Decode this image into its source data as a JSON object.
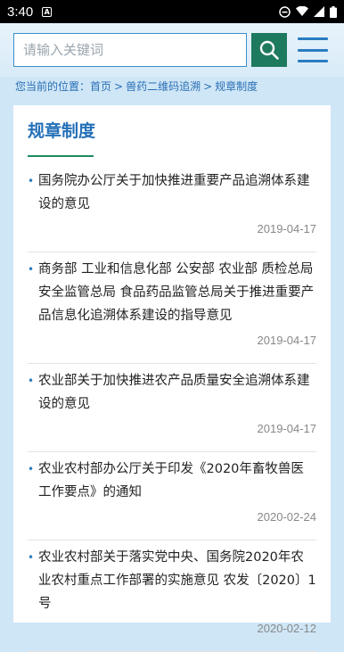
{
  "status_bar": {
    "time": "3:40",
    "notification_letter": "A"
  },
  "search": {
    "placeholder": "请输入关键词"
  },
  "breadcrumb": {
    "prefix": "您当前的位置：",
    "home": "首页",
    "sep1": ">",
    "section": "兽药二维码追溯",
    "sep2": ">",
    "current": "规章制度"
  },
  "page": {
    "title": "规章制度"
  },
  "articles": [
    {
      "title": "国务院办公厅关于加快推进重要产品追溯体系建设的意见",
      "date": "2019-04-17"
    },
    {
      "title": "商务部 工业和信息化部 公安部 农业部 质检总局 安全监管总局 食品药品监管总局关于推进重要产品信息化追溯体系建设的指导意见",
      "date": "2019-04-17"
    },
    {
      "title": "农业部关于加快推进农产品质量安全追溯体系建设的意见",
      "date": "2019-04-17"
    },
    {
      "title": "农业农村部办公厅关于印发《2020年畜牧兽医工作要点》的通知",
      "date": "2020-02-24"
    },
    {
      "title": "农业农村部关于落实党中央、国务院2020年农业农村重点工作部署的实施意见 农发〔2020〕1号",
      "date": "2020-02-12"
    }
  ],
  "colors": {
    "accent": "#2570b8",
    "search_button": "#1e7a5e",
    "background": "#cfe6f6"
  }
}
